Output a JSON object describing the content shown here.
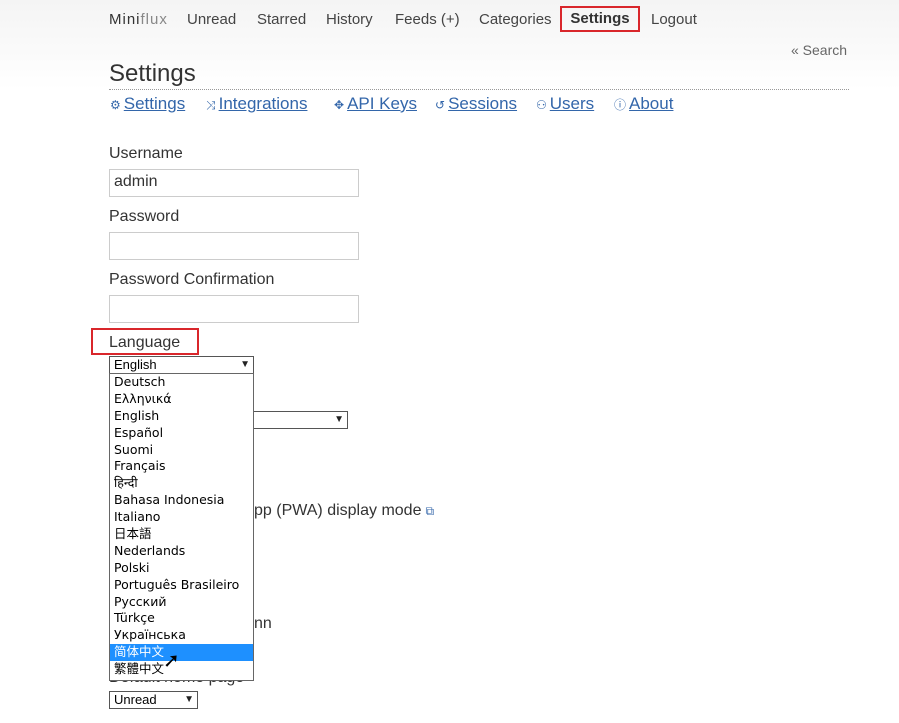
{
  "header": {
    "brand_mini": "Mini",
    "brand_flux": "flux",
    "nav": {
      "unread": "Unread",
      "starred": "Starred",
      "history": "History",
      "feeds": "Feeds (+)",
      "categories": "Categories",
      "settings": "Settings",
      "logout": "Logout"
    },
    "search_link": "« Search"
  },
  "page_title": "Settings",
  "subnav": {
    "settings": "Settings",
    "integrations": "Integrations",
    "api_keys": "API Keys",
    "sessions": "Sessions",
    "users": "Users",
    "about": "About"
  },
  "form": {
    "username_label": "Username",
    "username_value": "admin",
    "password_label": "Password",
    "password_confirmation_label": "Password Confirmation",
    "language_label": "Language",
    "language_selected": "English",
    "pwa_partial": "pp (PWA) display mode",
    "column_partial": "nn",
    "default_home_partial": "Default home page",
    "default_home_selected": "Unread"
  },
  "language_options": [
    "Deutsch",
    "Ελληνικά",
    "English",
    "Español",
    "Suomi",
    "Français",
    "हिन्दी",
    "Bahasa Indonesia",
    "Italiano",
    "日本語",
    "Nederlands",
    "Polski",
    "Português Brasileiro",
    "Русский",
    "Türkçe",
    "Українська",
    "简体中文",
    "繁體中文"
  ],
  "highlighted_option": "简体中文",
  "icons": {
    "settings": "gear-icon",
    "integrations": "plug-icon",
    "api_keys": "key-icon",
    "sessions": "history-icon",
    "users": "users-icon",
    "about": "info-icon",
    "external": "external-link-icon"
  },
  "colors": {
    "link": "#3366aa",
    "highlight_box": "#d9262b",
    "selected_option": "#1e90ff"
  }
}
